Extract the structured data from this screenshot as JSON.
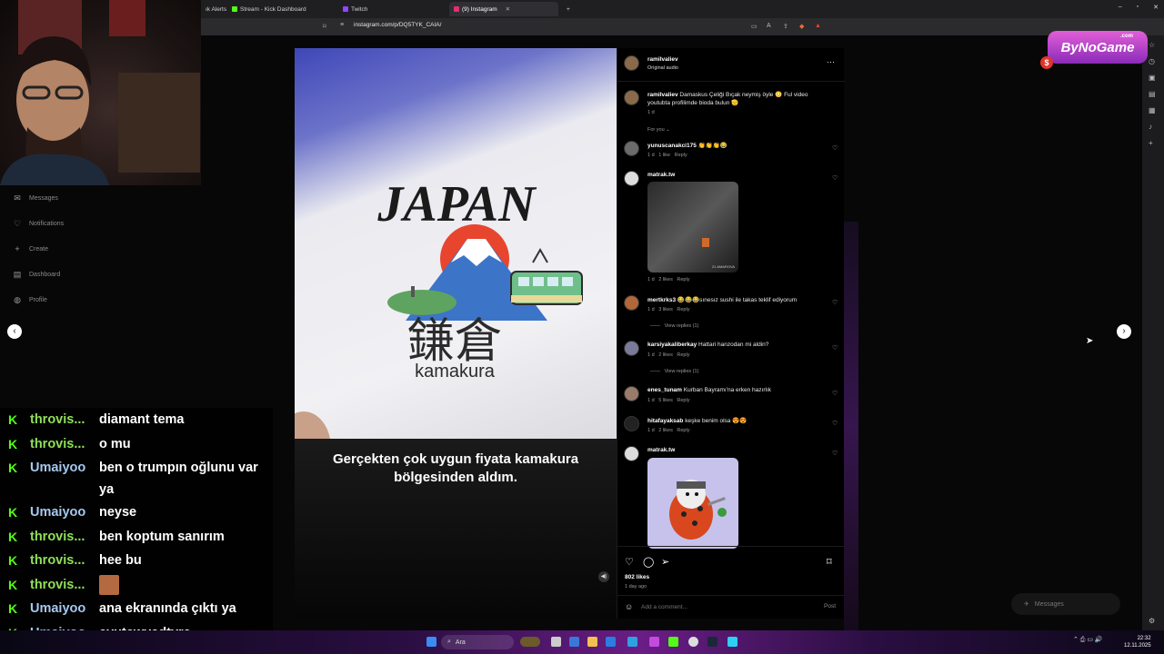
{
  "browser": {
    "tabs": [
      {
        "label": "ık Alerts"
      },
      {
        "label": "Stream - Kick Dashboard"
      },
      {
        "label": "Twitch"
      },
      {
        "label": "(9) Instagram"
      }
    ],
    "url": "instagram.com/p/DQ5TYK_CAIA/"
  },
  "ig_sidebar": {
    "items": [
      {
        "label": "Messages",
        "icon": "messages-icon"
      },
      {
        "label": "Notifications",
        "icon": "heart-icon"
      },
      {
        "label": "Create",
        "icon": "plus-icon"
      },
      {
        "label": "Dashboard",
        "icon": "dashboard-icon"
      },
      {
        "label": "Profile",
        "icon": "profile-icon"
      }
    ]
  },
  "post": {
    "author": "ramilvaliev",
    "audio": "Original audio",
    "overlay_caption": "Gerçekten çok uygun fiyata kamakura bölgesinden aldım.",
    "image_text": {
      "top": "JAPAN",
      "kanji": "鎌倉",
      "bottom": "kamakura"
    },
    "caption": {
      "user": "ramilvaliev",
      "text": "Damaskus Çeliği Bıçak neymiş öyle 😳 Ful video youtubta profilimde bioda bulun 🫡",
      "time": "1 d"
    },
    "sort_label": "For you",
    "likes": "802 likes",
    "posted": "1 day ago",
    "comment_placeholder": "Add a comment...",
    "post_button": "Post"
  },
  "comments": [
    {
      "user": "yunuscanakci175",
      "text": "👏👏👏😂",
      "meta": "1 d   1 like   Reply"
    },
    {
      "user": "matrak.tw",
      "text": "",
      "meta": "1 d   2 likes   Reply",
      "image_label": "21 AMAROVA"
    },
    {
      "user": "mertkrks3",
      "text": "😂😂😂sınesız sushi ile takas teklif ediyorum",
      "meta": "1 d   3 likes   Reply",
      "replies": "View replies (1)"
    },
    {
      "user": "karsiyakaliberkay",
      "text": "Hattari hanzodan mi aldin?",
      "meta": "1 d   2 likes   Reply",
      "replies": "View replies (1)"
    },
    {
      "user": "enes_tunam",
      "text": "Kurban Bayramı'na erken hazırlık",
      "meta": "1 d   5 likes   Reply"
    },
    {
      "user": "hitafayaksab",
      "text": "keşke benim olsa 😍😍",
      "meta": "1 d   2 likes   Reply"
    },
    {
      "user": "matrak.tw",
      "text": "",
      "meta": ""
    }
  ],
  "right_panel": {
    "messages_label": "Messages"
  },
  "watermark": {
    "brand": "ByNoGame",
    "suffix": ".com",
    "coin": "$"
  },
  "chat": [
    {
      "user": "throvis...",
      "msg": "diamant tema",
      "color": "#8fe05a"
    },
    {
      "user": "throvis...",
      "msg": "o mu",
      "color": "#8fe05a"
    },
    {
      "user": "Umaiyoo",
      "msg": "ben o trumpın oğlunu var ya",
      "color": "#a6c8f0"
    },
    {
      "user": "Umaiyoo",
      "msg": "neyse",
      "color": "#a6c8f0"
    },
    {
      "user": "throvis...",
      "msg": "ben koptum sanırım",
      "color": "#8fe05a"
    },
    {
      "user": "throvis...",
      "msg": "hee bu",
      "color": "#8fe05a"
    },
    {
      "user": "throvis...",
      "msg": "",
      "color": "#8fe05a",
      "emote": true
    },
    {
      "user": "Umaiyoo",
      "msg": "ana ekranında çıktı ya",
      "color": "#a6c8f0"
    },
    {
      "user": "Umaiyoo",
      "msg": "eyutewyedtyre",
      "color": "#a6c8f0"
    }
  ],
  "taskbar": {
    "search_label": "Ara",
    "time": "22:32",
    "date": "12.11.2025"
  },
  "colors": {
    "kick_green": "#53fc18",
    "accent": "#0095f6"
  }
}
